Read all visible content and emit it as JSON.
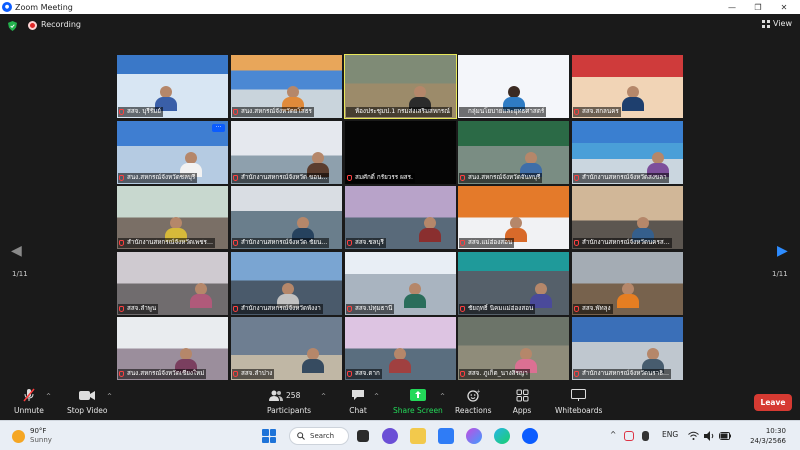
{
  "window": {
    "title": "Zoom Meeting",
    "controls": [
      "—",
      "❐",
      "✕"
    ]
  },
  "topbar": {
    "recording_label": "Recording",
    "view_label": "View"
  },
  "pager": {
    "left_page": "1/11",
    "right_page": "1/11"
  },
  "tiles": [
    {
      "name": "สสจ. บุรีรัมย์",
      "muted": true
    },
    {
      "name": "สนง.สหกรณ์จังหวัดยโสธร",
      "muted": true
    },
    {
      "name": "ห้องประชุมป.1 กรมส่งเสริมสหกรณ์",
      "muted": false
    },
    {
      "name": "กลุ่มนโยบายและยุทธศาสตร์",
      "muted": false
    },
    {
      "name": "สสจ.สกลนคร",
      "muted": true
    },
    {
      "name": "สนง.สหกรณ์จังหวัดชลบุรี",
      "muted": true
    },
    {
      "name": "สำนักงานสหกรณ์จังหวัด ขอน...",
      "muted": true
    },
    {
      "name": "สมศักดิ์ กรัยวรร ผสร.",
      "muted": true
    },
    {
      "name": "สนง.สหกรณ์จังหวัดจันทบุรี",
      "muted": true
    },
    {
      "name": "สำนักงานสหกรณ์จังหวัดสงขลา",
      "muted": true
    },
    {
      "name": "สำนักงานสหกรณ์จังหวัดเพชร...",
      "muted": true
    },
    {
      "name": "สำนักงานสหกรณ์จังหวัด ชัยน...",
      "muted": true
    },
    {
      "name": "สสจ.ชลบุรี",
      "muted": true
    },
    {
      "name": "สสจ.แม่ฮ่องสอน",
      "muted": true
    },
    {
      "name": "สำนักงานสหกรณ์จังหวัดนครส...",
      "muted": true
    },
    {
      "name": "สสจ.ลำพูน",
      "muted": true
    },
    {
      "name": "สำนักงานสหกรณ์จังหวัดพังงา",
      "muted": true
    },
    {
      "name": "สสจ.ปทุมธานี",
      "muted": true
    },
    {
      "name": "ชัยฤทธิ์ นิคมแม่ฮ่องสอน",
      "muted": true
    },
    {
      "name": "สสจ.พัทลุง",
      "muted": true
    },
    {
      "name": "สนง.สหกรณ์จังหวัดเชียงใหม่",
      "muted": true
    },
    {
      "name": "สสจ.ลำปาง",
      "muted": true
    },
    {
      "name": "สสจ.ตาก",
      "muted": true
    },
    {
      "name": "สสจ. ภูเก็ต_นางสิรญา",
      "muted": true
    },
    {
      "name": "สำนักงานสหกรณ์จังหวัดนราธิ...",
      "muted": true
    }
  ],
  "toolbar": {
    "unmute": "Unmute",
    "stop_video": "Stop Video",
    "participants": "Participants",
    "participants_count": "258",
    "chat": "Chat",
    "share_screen": "Share Screen",
    "reactions": "Reactions",
    "apps": "Apps",
    "whiteboards": "Whiteboards",
    "leave": "Leave"
  },
  "taskbar": {
    "weather_temp": "90°F",
    "weather_desc": "Sunny",
    "search_label": "Search",
    "lang": "ENG",
    "time": "10:30",
    "date": "24/3/2566"
  },
  "colors": {
    "accent": "#0b5cff",
    "leave": "#d63a32",
    "share": "#23d959",
    "active_speaker": "#e8e85a"
  }
}
